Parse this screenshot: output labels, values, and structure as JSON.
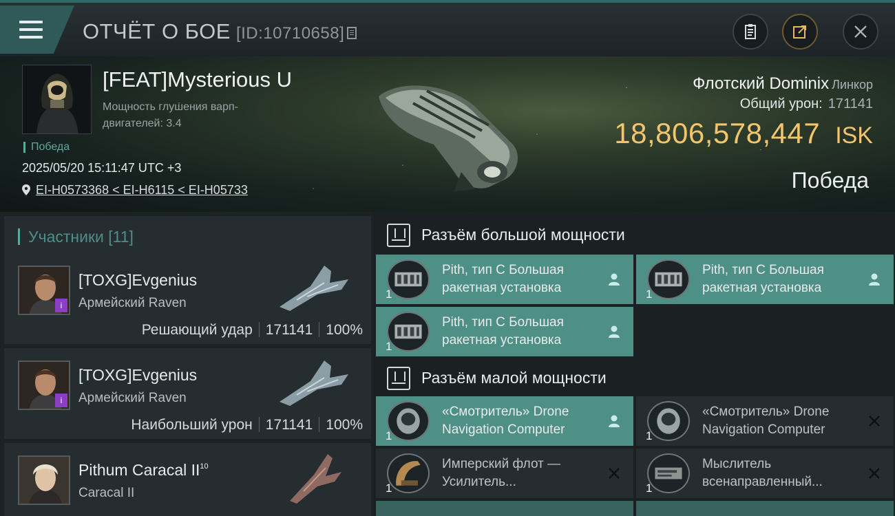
{
  "header": {
    "title": "ОТЧЁТ О БОЕ",
    "report_id": "[ID:10710658]"
  },
  "victim": {
    "name": "[FEAT]Mysterious U",
    "warp_label": "Мощность глушения варп-двигателей: 3.4",
    "status_tag": "Победа",
    "datetime": "2025/05/20 15:11:47 UTC +3",
    "location": "EI-H0573368 < EI-H6115 < EI-H05733",
    "ship": "Флотский Dominix",
    "ship_class": "Линкор",
    "damage_label": "Общий урон:",
    "damage_value": "171141",
    "isk_value": "18,806,578,447",
    "isk_currency": "ISK",
    "outcome": "Победа"
  },
  "participants": {
    "heading": "Участники [11]",
    "items": [
      {
        "name": "[TOXG]Evgenius",
        "ship": "Армейский Raven",
        "role": "Решающий удар",
        "damage": "171141",
        "percent": "100%"
      },
      {
        "name": "[TOXG]Evgenius",
        "ship": "Армейский Raven",
        "role": "Наибольший урон",
        "damage": "171141",
        "percent": "100%"
      },
      {
        "name": "Pithum Caracal II",
        "level": "10",
        "ship": "Caracal II"
      }
    ]
  },
  "modules": {
    "high_title": "Разъём большой мощности",
    "low_title": "Разъём малой мощности",
    "high": [
      {
        "name": "Pith, тип C Большая ракетная установка",
        "qty": "1",
        "state": "fitted"
      },
      {
        "name": "Pith, тип C Большая ракетная установка",
        "qty": "1",
        "state": "fitted"
      },
      {
        "name": "Pith, тип C Большая ракетная установка",
        "qty": "1",
        "state": "fitted"
      }
    ],
    "low": [
      {
        "name": "«Смотритель» Drone Navigation Computer",
        "qty": "1",
        "state": "fitted"
      },
      {
        "name": "«Смотритель» Drone Navigation Computer",
        "qty": "1",
        "state": "destroyed"
      },
      {
        "name": "Имперский флот — Усилитель...",
        "qty": "1",
        "state": "destroyed"
      },
      {
        "name": "Мыслитель всенаправленный...",
        "qty": "1",
        "state": "destroyed"
      }
    ]
  },
  "colors": {
    "accent": "#4e8f86",
    "isk": "#f3c56c",
    "badge": "#8b3fc7"
  }
}
